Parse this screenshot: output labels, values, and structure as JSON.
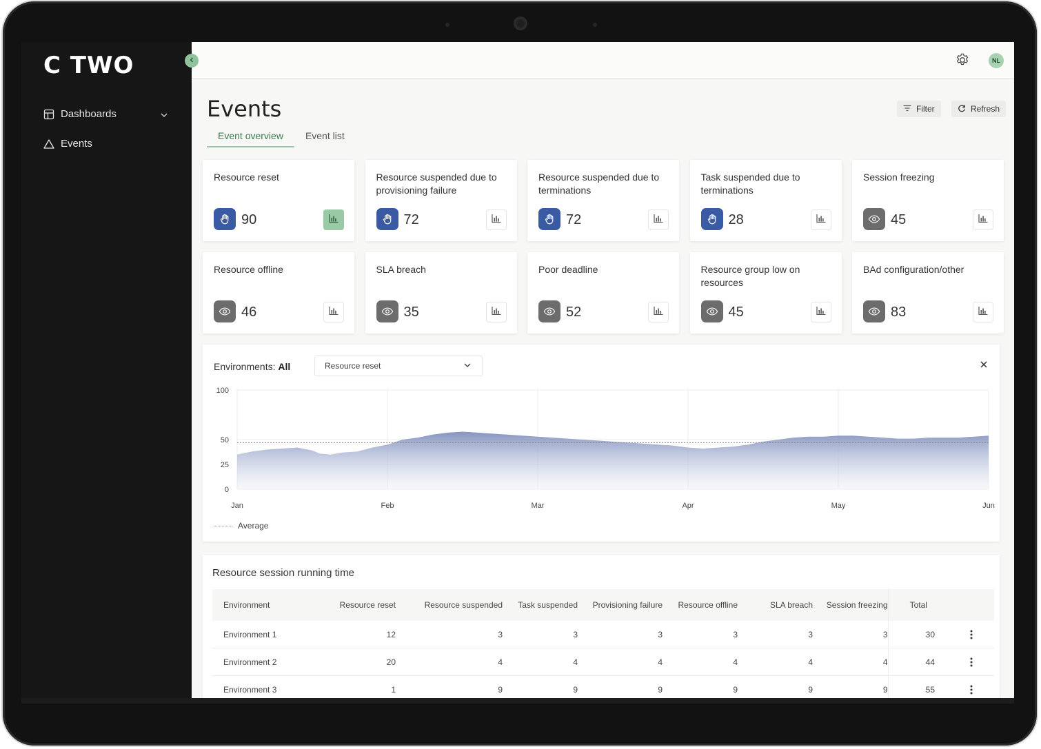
{
  "app": {
    "logo": "C TWO",
    "user_initials": "NL"
  },
  "sidebar": {
    "items": [
      {
        "label": "Dashboards",
        "icon": "dashboard-icon",
        "has_submenu": true
      },
      {
        "label": "Events",
        "icon": "warning-triangle-icon"
      }
    ]
  },
  "header": {
    "title": "Events",
    "filter_label": "Filter",
    "refresh_label": "Refresh",
    "tabs": [
      {
        "label": "Event overview",
        "active": true
      },
      {
        "label": "Event list",
        "active": false
      }
    ]
  },
  "cards": [
    {
      "title": "Resource reset",
      "value": "90",
      "icon": "hand-icon",
      "chart_active": true
    },
    {
      "title": "Resource suspended due to provisioning failure",
      "value": "72",
      "icon": "hand-icon",
      "chart_active": false
    },
    {
      "title": "Resource suspended due to terminations",
      "value": "72",
      "icon": "hand-icon",
      "chart_active": false
    },
    {
      "title": "Task suspended due to terminations",
      "value": "28",
      "icon": "hand-icon",
      "chart_active": false
    },
    {
      "title": "Session freezing",
      "value": "45",
      "icon": "eye-icon",
      "chart_active": false
    },
    {
      "title": "Resource offline",
      "value": "46",
      "icon": "eye-icon",
      "chart_active": false
    },
    {
      "title": "SLA breach",
      "value": "35",
      "icon": "eye-icon",
      "chart_active": false
    },
    {
      "title": "Poor deadline",
      "value": "52",
      "icon": "eye-icon",
      "chart_active": false
    },
    {
      "title": "Resource group low on resources",
      "value": "45",
      "icon": "eye-icon",
      "chart_active": false
    },
    {
      "title": "BAd configuration/other",
      "value": "83",
      "icon": "eye-icon",
      "chart_active": false
    }
  ],
  "chart_panel": {
    "env_prefix": "Environments: ",
    "env_value": "All",
    "selected_metric": "Resource reset",
    "legend_label": "Average"
  },
  "chart_data": {
    "type": "area",
    "x": [
      "Jan",
      "Feb",
      "Mar",
      "Apr",
      "May",
      "Jun"
    ],
    "x_positions": [
      0,
      0.1,
      0.2,
      0.3,
      0.4,
      0.5,
      0.55,
      0.62,
      0.7,
      0.8,
      0.9,
      1.0,
      1.1,
      1.2,
      1.3,
      1.4,
      1.5,
      1.6,
      1.7,
      1.8,
      1.9,
      2.0,
      2.1,
      2.2,
      2.3,
      2.4,
      2.5,
      2.6,
      2.7,
      2.8,
      2.9,
      3.0,
      3.1,
      3.2,
      3.3,
      3.4,
      3.5,
      3.6,
      3.7,
      3.8,
      3.9,
      4.0,
      4.1,
      4.2,
      4.3,
      4.4,
      4.5,
      4.6,
      4.7,
      4.8,
      4.9,
      5.0
    ],
    "series": [
      {
        "values": [
          35,
          38,
          40,
          41,
          42,
          39,
          36,
          35,
          37,
          38,
          42,
          45,
          50,
          52,
          55,
          57,
          58,
          57,
          56,
          55,
          54,
          53,
          52,
          51,
          50,
          49,
          48,
          47,
          46,
          45,
          44,
          42,
          41,
          42,
          43,
          45,
          48,
          50,
          52,
          53,
          53,
          54,
          54,
          53,
          52,
          51,
          51,
          52,
          52,
          52,
          53,
          54
        ]
      }
    ],
    "average": 47,
    "ylim": [
      0,
      100
    ],
    "yticks": [
      {
        "value": 0,
        "label": "0"
      },
      {
        "value": 25,
        "label": "25"
      },
      {
        "value": 50,
        "label": "50"
      },
      {
        "value": 100,
        "label": "100"
      }
    ],
    "legend": [
      "Average"
    ]
  },
  "table": {
    "title": "Resource session running time",
    "columns": [
      "Environment",
      "Resource reset",
      "Resource suspended",
      "Task suspended",
      "Provisioning failure",
      "Resource offline",
      "SLA breach",
      "Session freezing",
      "Total"
    ],
    "rows": [
      [
        "Environment 1",
        "12",
        "3",
        "3",
        "3",
        "3",
        "3",
        "3",
        "30"
      ],
      [
        "Environment 2",
        "20",
        "4",
        "4",
        "4",
        "4",
        "4",
        "4",
        "44"
      ],
      [
        "Environment 3",
        "1",
        "9",
        "9",
        "9",
        "9",
        "9",
        "9",
        "55"
      ]
    ]
  }
}
